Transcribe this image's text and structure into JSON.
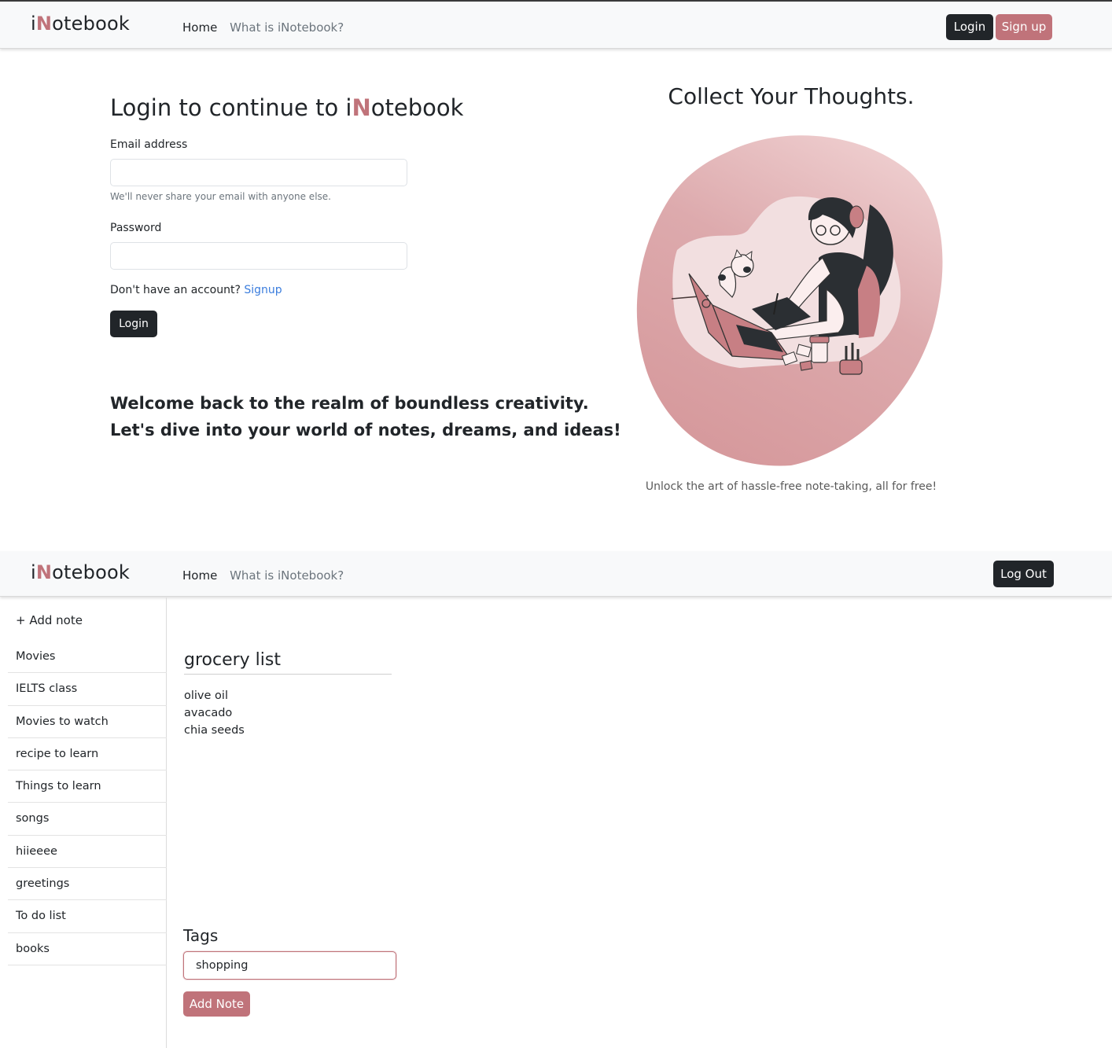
{
  "login_page": {
    "navbar": {
      "brand_prefix": "i",
      "brand_accent": "N",
      "brand_suffix": "otebook",
      "home": "Home",
      "what": "What is iNotebook?",
      "login": "Login",
      "signup": "Sign up"
    },
    "form": {
      "title_prefix": "Login to continue to i",
      "title_accent": "N",
      "title_suffix": "otebook",
      "email_label": "Email address",
      "email_value": "",
      "email_help": "We'll never share your email with anyone else.",
      "password_label": "Password",
      "password_value": "",
      "account_text": "Don't have an account? ",
      "signup_link": "Signup",
      "login_button": "Login"
    },
    "welcome_line1": "Welcome back to the realm of boundless creativity.",
    "welcome_line2": "Let's dive into your world of notes, dreams, and ideas!",
    "hero_title": "Collect Your Thoughts.",
    "hero_caption": "Unlock the art of hassle-free note-taking, all for free!"
  },
  "notes_page": {
    "navbar": {
      "brand_prefix": "i",
      "brand_accent": "N",
      "brand_suffix": "otebook",
      "home": "Home",
      "what": "What is iNotebook?",
      "logout": "Log Out"
    },
    "sidebar": {
      "add_note": "+ Add note",
      "notes": [
        "Movies",
        "IELTS class",
        "Movies to watch",
        "recipe to learn",
        "Things to learn",
        "songs",
        "hiieeee",
        "greetings",
        "To do list",
        "books"
      ]
    },
    "editor": {
      "title": "grocery list",
      "body": "olive oil\navacado\nchia seeds",
      "tags_label": "Tags",
      "tags_value": "shopping",
      "add_button": "Add Note"
    }
  },
  "colors": {
    "accent": "#c0737a",
    "dark_button": "#212529",
    "link": "#3b7ddd",
    "navbar_bg": "#f8f9fa"
  },
  "icons": {
    "add": "plus-icon",
    "illustration": "woman-drawing-with-cat-illustration"
  }
}
